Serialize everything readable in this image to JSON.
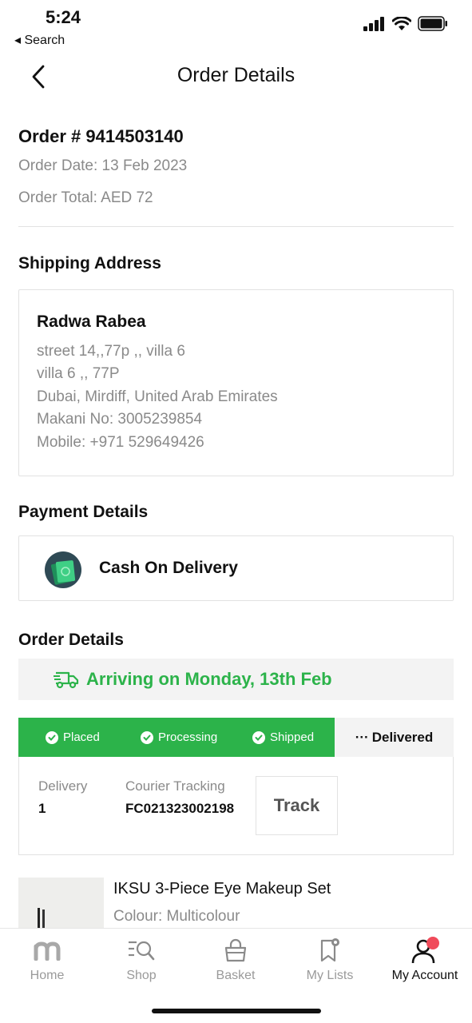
{
  "status_bar": {
    "time": "5:24",
    "back_label": "◂ Search"
  },
  "header": {
    "title": "Order Details"
  },
  "order": {
    "number": "Order # 9414503140",
    "date": "Order Date: 13 Feb 2023",
    "total": "Order Total: AED 72"
  },
  "shipping": {
    "section_title": "Shipping Address",
    "name": "Radwa Rabea",
    "lines": [
      "street 14,,77p ,, villa 6",
      "villa 6 ,, 77P",
      "Dubai, Mirdiff, United Arab Emirates",
      "Makani No: 3005239854",
      "Mobile: +971 529649426"
    ]
  },
  "payment": {
    "section_title": "Payment Details",
    "method": "Cash On Delivery",
    "icon": "cash-icon"
  },
  "order_details": {
    "section_title": "Order Details",
    "arrival": "Arriving on Monday, 13th Feb",
    "steps": [
      {
        "label": "Placed",
        "done": true
      },
      {
        "label": "Processing",
        "done": true
      },
      {
        "label": "Shipped",
        "done": true
      },
      {
        "label": "Delivered",
        "done": false
      }
    ],
    "pending_prefix": "···",
    "delivery_label": "Delivery",
    "delivery_value": "1",
    "tracking_label": "Courier Tracking",
    "tracking_value": "FC021323002198",
    "track_button": "Track"
  },
  "product": {
    "name": "IKSU 3-Piece Eye Makeup Set",
    "colour": "Colour: Multicolour"
  },
  "tab_bar": {
    "tabs": [
      {
        "label": "Home",
        "icon": "home-logo-icon"
      },
      {
        "label": "Shop",
        "icon": "search-list-icon"
      },
      {
        "label": "Basket",
        "icon": "basket-icon"
      },
      {
        "label": "My Lists",
        "icon": "bookmark-icon"
      },
      {
        "label": "My Account",
        "icon": "account-icon"
      }
    ],
    "active": "My Account"
  },
  "colors": {
    "accent_green": "#2cb34a",
    "text_grey": "#8a8a8a",
    "notification_red": "#f04a5a"
  }
}
